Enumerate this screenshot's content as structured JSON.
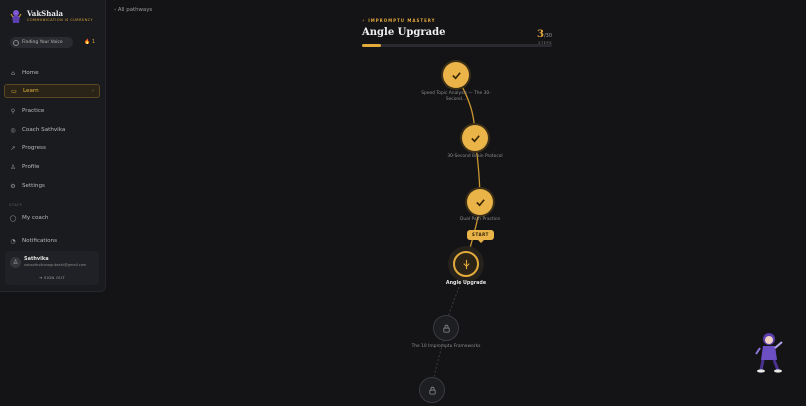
{
  "brand": {
    "name": "VakShala",
    "tagline": "COMMUNICATION IS CURRENCY"
  },
  "status_pill": {
    "label": "Finding Your Voice",
    "streak": "1"
  },
  "nav": [
    {
      "label": "Home",
      "icon": "home-icon"
    },
    {
      "label": "Learn",
      "icon": "book-icon",
      "active": true
    },
    {
      "label": "Practice",
      "icon": "practice-icon"
    },
    {
      "label": "Coach Sathvika",
      "icon": "coach-icon"
    },
    {
      "label": "Progress",
      "icon": "trend-icon"
    },
    {
      "label": "Profile",
      "icon": "user-icon"
    },
    {
      "label": "Settings",
      "icon": "gear-icon"
    }
  ],
  "staff_section": {
    "label": "STAFF",
    "my_coach": "My coach"
  },
  "notifications": "Notifications",
  "user": {
    "name": "Sathvika",
    "email": "sairsathvikanagukeshi@gmail.com",
    "sign_out": "SIGN OUT"
  },
  "back_link": "All pathways",
  "pathway": {
    "kicker": "IMPROMPTU MASTERY",
    "title": "Angle Upgrade",
    "current": "3",
    "total": "/30",
    "steps_label": "STEPS",
    "progress": 0.1
  },
  "nodes": [
    {
      "label": "Speed Topic Analysis — The 30-Second...",
      "state": "done"
    },
    {
      "label": "30-Second Brain Protocol",
      "state": "done"
    },
    {
      "label": "Dual Path Practice",
      "state": "done"
    },
    {
      "label": "Angle Upgrade",
      "state": "current",
      "tip": "START"
    },
    {
      "label": "The 10 Impromptu Frameworks",
      "state": "locked"
    },
    {
      "label": "",
      "state": "locked"
    }
  ],
  "colors": {
    "accent": "#e2a93b",
    "background": "#141416",
    "sidebar": "#1a1b1f"
  }
}
